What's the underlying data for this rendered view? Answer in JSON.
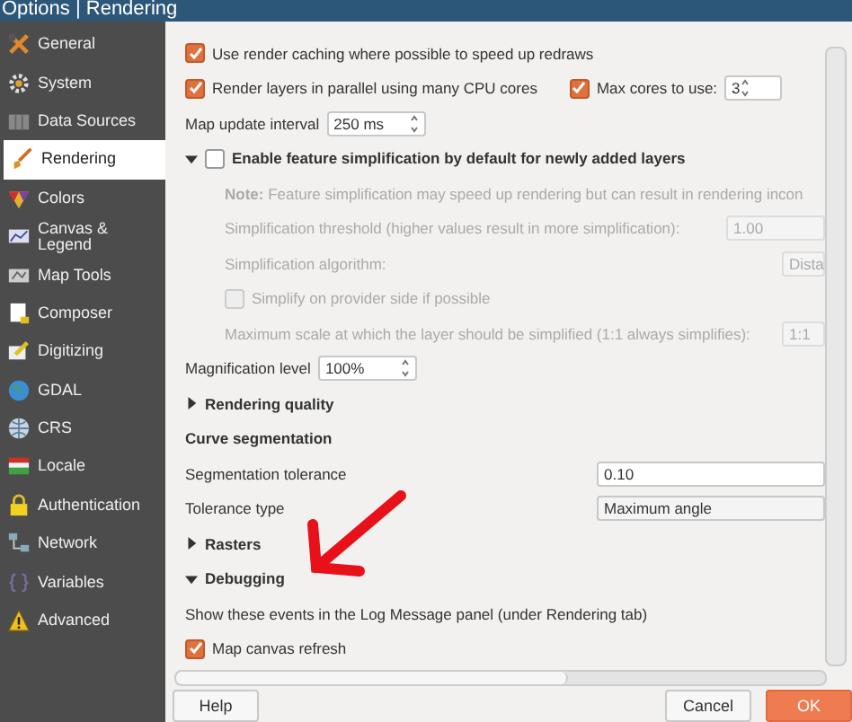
{
  "window": {
    "title": "Options | Rendering"
  },
  "sidebar": {
    "items": [
      {
        "label": "General",
        "selected": false
      },
      {
        "label": "System",
        "selected": false
      },
      {
        "label": "Data Sources",
        "selected": false
      },
      {
        "label": "Rendering",
        "selected": true
      },
      {
        "label": "Colors",
        "selected": false
      },
      {
        "label": "Canvas & Legend",
        "selected": false
      },
      {
        "label": "Map Tools",
        "selected": false
      },
      {
        "label": "Composer",
        "selected": false
      },
      {
        "label": "Digitizing",
        "selected": false
      },
      {
        "label": "GDAL",
        "selected": false
      },
      {
        "label": "CRS",
        "selected": false
      },
      {
        "label": "Locale",
        "selected": false
      },
      {
        "label": "Authentication",
        "selected": false
      },
      {
        "label": "Network",
        "selected": false
      },
      {
        "label": "Variables",
        "selected": false
      },
      {
        "label": "Advanced",
        "selected": false
      }
    ]
  },
  "rows": [
    {
      "kind": "checkbox",
      "label": "Use render caching where possible to speed up redraws",
      "checked": true
    },
    {
      "kind": "checkbox",
      "label": "Render layers in parallel using many CPU cores",
      "checked": true,
      "extra": {
        "label": "Max cores to use:",
        "checked": true,
        "value": "3"
      }
    },
    {
      "kind": "field",
      "label": "Map update interval",
      "control": {
        "kind": "spin",
        "value": "250 ms"
      }
    },
    {
      "kind": "group",
      "label": "Enable feature simplification by default for newly added layers",
      "expanded": true,
      "checked": false,
      "children": [
        {
          "kind": "note",
          "text": "**Note:** Feature simplification may speed up rendering but can result in rendering incon",
          "disabled": true
        },
        {
          "kind": "field",
          "label": "Simplification threshold (higher values result in more simplification):",
          "control": {
            "kind": "spin",
            "value": "1.00"
          },
          "disabled": true
        },
        {
          "kind": "field",
          "label": "Simplification algorithm:",
          "control": {
            "kind": "combo",
            "value": "Dista"
          },
          "disabled": true
        },
        {
          "kind": "checkbox",
          "label": "Simplify on provider side if possible",
          "checked": false,
          "disabled": true
        },
        {
          "kind": "field",
          "label": "Maximum scale at which the layer should be simplified (1:1 always simplifies):",
          "control": {
            "kind": "combo",
            "value": "1:1"
          },
          "disabled": true
        }
      ]
    },
    {
      "kind": "field",
      "label": "Magnification level",
      "control": {
        "kind": "spin",
        "value": "100%"
      }
    },
    {
      "kind": "section",
      "label": "Rendering quality",
      "expanded": false
    },
    {
      "kind": "heading",
      "label": "Curve segmentation"
    },
    {
      "kind": "field",
      "label": "Segmentation tolerance",
      "control": {
        "kind": "text",
        "value": "0.10"
      }
    },
    {
      "kind": "field",
      "label": "Tolerance type",
      "control": {
        "kind": "combo",
        "value": "Maximum angle"
      }
    },
    {
      "kind": "section",
      "label": "Rasters",
      "expanded": false
    },
    {
      "kind": "section",
      "label": "Debugging",
      "expanded": true,
      "children": [
        {
          "kind": "note",
          "text": "Show these events in the Log Message panel (under Rendering tab)"
        },
        {
          "kind": "checkbox",
          "label": "Map canvas refresh",
          "checked": true
        }
      ]
    }
  ],
  "buttons": [
    {
      "label": "Help",
      "kind": "plain"
    },
    {
      "label": "Cancel",
      "kind": "plain"
    },
    {
      "label": "OK",
      "kind": "default"
    }
  ]
}
